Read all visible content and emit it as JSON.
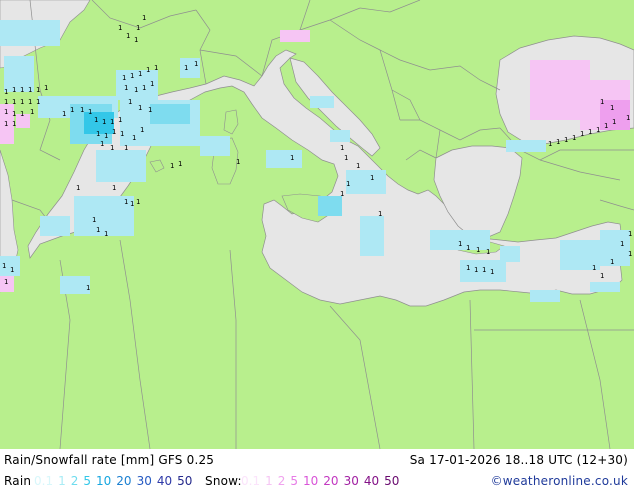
{
  "title": "Rain/Snowfall rate [mm] GFS 0.25",
  "datetime": "Sa 17-01-2026 18..18 UTC (12+30)",
  "rain_label": "Rain",
  "snow_label": "Snow:",
  "credit": "©weatheronline.co.uk",
  "rain_scale": [
    {
      "text": "0.1",
      "color": "#d8f7fb"
    },
    {
      "text": "1",
      "color": "#a9ecf5"
    },
    {
      "text": "2",
      "color": "#6fdcee"
    },
    {
      "text": "5",
      "color": "#33c7e8"
    },
    {
      "text": "10",
      "color": "#17a6e0"
    },
    {
      "text": "20",
      "color": "#1a7fd1"
    },
    {
      "text": "30",
      "color": "#2559c2"
    },
    {
      "text": "40",
      "color": "#2f3aa8"
    },
    {
      "text": "50",
      "color": "#262a8c"
    }
  ],
  "snow_scale": [
    {
      "text": "0.1",
      "color": "#fbe3fb"
    },
    {
      "text": "1",
      "color": "#f6c5f4"
    },
    {
      "text": "2",
      "color": "#f0a3ee"
    },
    {
      "text": "5",
      "color": "#e77be6"
    },
    {
      "text": "10",
      "color": "#d954d8"
    },
    {
      "text": "20",
      "color": "#c237c1"
    },
    {
      "text": "30",
      "color": "#a11fa2"
    },
    {
      "text": "40",
      "color": "#831187"
    },
    {
      "text": "50",
      "color": "#690a6f"
    }
  ],
  "colors": {
    "land": "#b8ef8d",
    "sea": "#e6e6e6",
    "border": "#8f8f8f",
    "rain_light": "#aee8f4",
    "rain_medium": "#7edcef",
    "snow_light": "#f6c5f4",
    "snow_medium": "#ee9fee"
  }
}
